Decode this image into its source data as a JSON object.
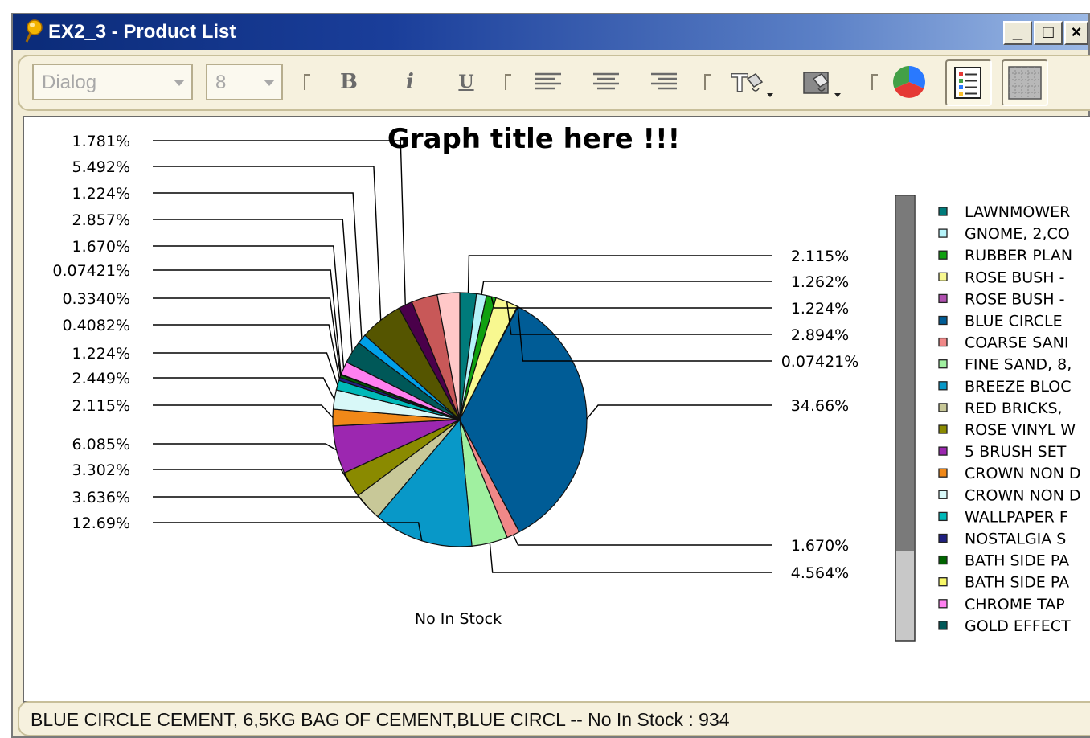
{
  "window": {
    "title": "EX2_3 - Product List",
    "controls": [
      "_",
      "□",
      "×"
    ]
  },
  "toolbar": {
    "font_name": "Dialog",
    "font_size": "8",
    "buttons": [
      {
        "name": "bold",
        "label": "B"
      },
      {
        "name": "italic",
        "label": "i"
      },
      {
        "name": "underline",
        "label": "U"
      },
      {
        "name": "align-left",
        "icon": "align-left-icon"
      },
      {
        "name": "align-center",
        "icon": "align-center-icon"
      },
      {
        "name": "align-right",
        "icon": "align-right-icon"
      },
      {
        "name": "text-color",
        "icon": "text-color-icon"
      },
      {
        "name": "fill-color",
        "icon": "fill-color-icon"
      },
      {
        "name": "pie-chart",
        "icon": "pie-chart-icon"
      },
      {
        "name": "show-legend",
        "icon": "legend-icon",
        "pressed": true
      },
      {
        "name": "show-grid",
        "icon": "grid-icon",
        "pressed": true
      }
    ]
  },
  "chart_data": {
    "type": "pie",
    "title": "Graph title here !!!",
    "xlabel": "No In Stock",
    "labels": [
      "2.115%",
      "1.262%",
      "1.224%",
      "2.894%",
      "0.07421%",
      "34.66%",
      "1.670%",
      "4.564%",
      "12.69%",
      "3.636%",
      "3.302%",
      "6.085%",
      "2.115%",
      "2.449%",
      "1.224%",
      "0.4082%",
      "0.3340%",
      "0.07421%",
      "1.670%",
      "2.857%",
      "1.224%",
      "5.492%",
      "1.781%"
    ],
    "series": [
      {
        "name": "LAWNMOWER",
        "value": 2.115,
        "color": "#007b7b"
      },
      {
        "name": "GNOME, 2,CO",
        "value": 1.262,
        "color": "#b5f3f9"
      },
      {
        "name": "RUBBER PLAN",
        "value": 1.224,
        "color": "#10a010"
      },
      {
        "name": "ROSE BUSH -",
        "value": 2.894,
        "color": "#f8f890"
      },
      {
        "name": "ROSE BUSH -",
        "value": 0.07421,
        "color": "#b050b0"
      },
      {
        "name": "BLUE CIRCLE",
        "value": 34.66,
        "color": "#005c96"
      },
      {
        "name": "COARSE SANI",
        "value": 1.67,
        "color": "#f08888"
      },
      {
        "name": "FINE SAND, 8,",
        "value": 4.564,
        "color": "#a0f0a0"
      },
      {
        "name": "BREEZE BLOC",
        "value": 12.69,
        "color": "#0898c8"
      },
      {
        "name": "RED BRICKS,",
        "value": 3.636,
        "color": "#c8c898"
      },
      {
        "name": "ROSE VINYL W",
        "value": 3.302,
        "color": "#8a8a00"
      },
      {
        "name": "5 BRUSH SET",
        "value": 6.085,
        "color": "#9c27b0"
      },
      {
        "name": "CROWN NON D",
        "value": 2.115,
        "color": "#f08818"
      },
      {
        "name": "CROWN NON D",
        "value": 2.449,
        "color": "#d8f8f8"
      },
      {
        "name": "WALLPAPER F",
        "value": 1.224,
        "color": "#00b8b8"
      },
      {
        "name": "NOSTALGIA S",
        "value": 0.4082,
        "color": "#202080"
      },
      {
        "name": "BATH SIDE PA",
        "value": 0.334,
        "color": "#006400"
      },
      {
        "name": "BATH SIDE PA",
        "value": 0.07421,
        "color": "#f8f868"
      },
      {
        "name": "CHROME TAP",
        "value": 1.67,
        "color": "#ff80f0"
      },
      {
        "name": "GOLD EFFECT",
        "value": 2.857,
        "color": "#005858"
      },
      {
        "name": "",
        "value": 1.224,
        "color": "#00a0e8"
      },
      {
        "name": "",
        "value": 5.492,
        "color": "#555500"
      },
      {
        "name": "",
        "value": 1.781,
        "color": "#4a004a"
      },
      {
        "name": "",
        "value": 3.302,
        "color": "#c85858"
      },
      {
        "name": "",
        "value": 2.857,
        "color": "#ffc8c8"
      }
    ],
    "legend_position": "right",
    "legend_scroll": 0.8
  },
  "status": {
    "text": "BLUE CIRCLE CEMENT, 6,5KG BAG OF CEMENT,BLUE CIRCL -- No In Stock :  934"
  }
}
